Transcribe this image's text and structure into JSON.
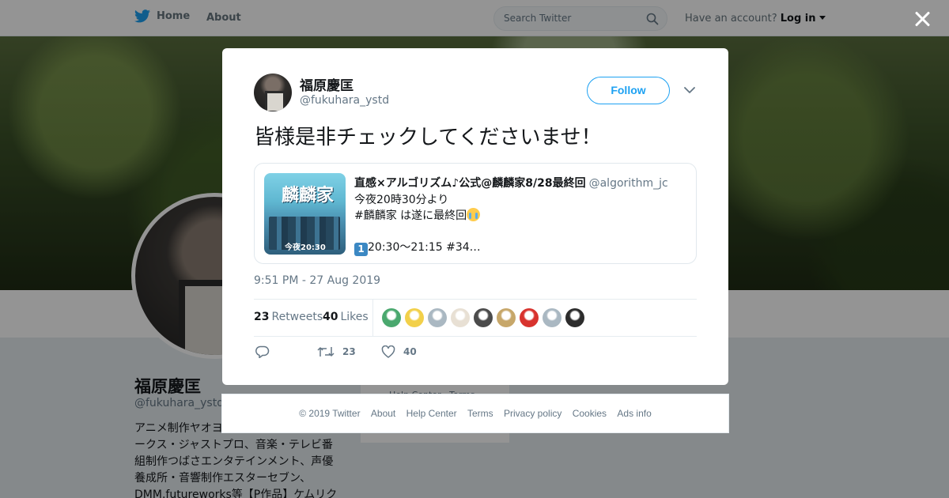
{
  "topnav": {
    "home_label": "Home",
    "about_label": "About",
    "search_placeholder": "Search Twitter",
    "account_prompt": "Have an account?",
    "login_label": "Log in"
  },
  "profile": {
    "name": "福原慶匡",
    "handle": "@fukuhara_ystd",
    "bio": "アニメ制作ヤオヨロズ・プロデュースワークス・ジャストプロ、音楽・テレビ番組制作つばさエンタテインメント、声優養成所・音響制作エスターセブン、DMM.futureworks等【P作品】ケムリク",
    "side_card_text": "Help Center · Terms"
  },
  "tweet": {
    "author_name": "福原慶匡",
    "author_handle": "@fukuhara_ystd",
    "follow_label": "Follow",
    "text": "皆様是非チェックしてくださいませ！",
    "timestamp": "9:51 PM - 27 Aug 2019",
    "retweets_count": "23",
    "retweets_label": "Retweets",
    "likes_count": "40",
    "likes_label": "Likes",
    "retweet_action_count": "23",
    "like_action_count": "40"
  },
  "quote": {
    "author_name": "直感×アルゴリズム♪公式@麟麟家8/28最終回",
    "author_handle": "@algorithm_jc",
    "line1": "今夜20時30分より",
    "line2": "#麟麟家 は遂に最終回",
    "line3": "20:30～21:15 #34…",
    "media_title": "麟麟家",
    "media_caption": "今夜20:30"
  },
  "likers": [
    {
      "name": "liker-1",
      "color": "#4aa86e"
    },
    {
      "name": "liker-2",
      "color": "#f2d04a"
    },
    {
      "name": "liker-3",
      "color": "#aab8c2"
    },
    {
      "name": "liker-4",
      "color": "#e8e0d4"
    },
    {
      "name": "liker-5",
      "color": "#4b4b4b"
    },
    {
      "name": "liker-6",
      "color": "#c7a76a"
    },
    {
      "name": "liker-7",
      "color": "#d8332e"
    },
    {
      "name": "liker-8",
      "color": "#aab8c2"
    },
    {
      "name": "liker-9",
      "color": "#2c2c2c"
    }
  ],
  "footer": {
    "copyright": "© 2019 Twitter",
    "about": "About",
    "help": "Help Center",
    "terms": "Terms",
    "privacy": "Privacy policy",
    "cookies": "Cookies",
    "ads": "Ads info"
  },
  "colors": {
    "accent": "#1da1f2",
    "muted": "#657786",
    "text": "#14171a"
  }
}
